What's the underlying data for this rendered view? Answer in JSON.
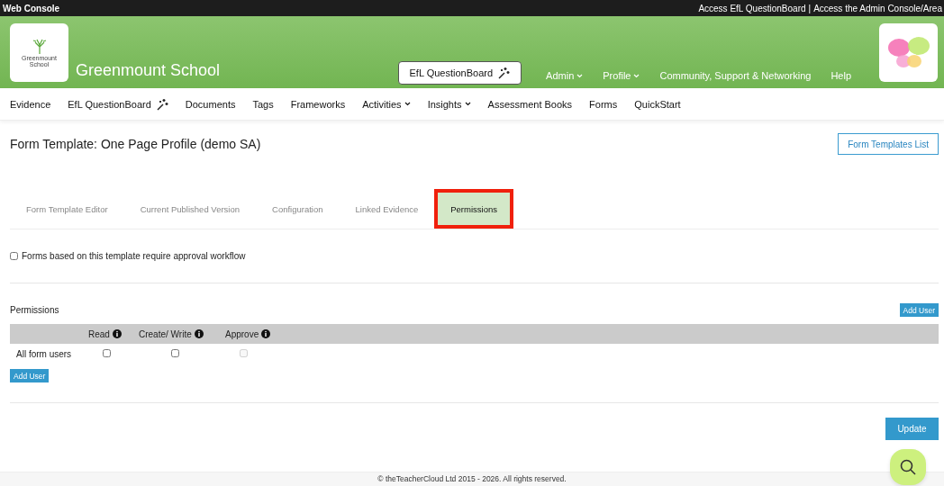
{
  "top_bar": {
    "title": "Web Console",
    "links": [
      "Access EfL QuestionBoard",
      "Access the Admin Console/Area"
    ],
    "separator": "|"
  },
  "header": {
    "school_name": "Greenmount School",
    "logo_caption": "Greenmount School",
    "questionboard_button": "EfL QuestionBoard",
    "menu": [
      {
        "label": "Admin",
        "kind": "dropdown"
      },
      {
        "label": "Profile",
        "kind": "dropdown"
      },
      {
        "label": "Community, Support & Networking",
        "kind": "link"
      },
      {
        "label": "Help",
        "kind": "link"
      }
    ]
  },
  "nav": [
    {
      "label": "Evidence",
      "kind": "link"
    },
    {
      "label": "EfL QuestionBoard",
      "kind": "wand"
    },
    {
      "label": "Documents",
      "kind": "link"
    },
    {
      "label": "Tags",
      "kind": "link"
    },
    {
      "label": "Frameworks",
      "kind": "link"
    },
    {
      "label": "Activities",
      "kind": "dropdown"
    },
    {
      "label": "Insights",
      "kind": "dropdown"
    },
    {
      "label": "Assessment Books",
      "kind": "link"
    },
    {
      "label": "Forms",
      "kind": "link"
    },
    {
      "label": "QuickStart",
      "kind": "link"
    }
  ],
  "page_title": "Form Template: One Page Profile (demo SA)",
  "list_button": "Form Templates List",
  "tabs": [
    {
      "label": "Form Template Editor",
      "selected": false,
      "highlighted": false
    },
    {
      "label": "Current Published Version",
      "selected": false,
      "highlighted": false
    },
    {
      "label": "Configuration",
      "selected": false,
      "highlighted": false
    },
    {
      "label": "Linked Evidence",
      "selected": false,
      "highlighted": false
    },
    {
      "label": "Permissions",
      "selected": true,
      "highlighted": true
    }
  ],
  "approval": {
    "label": "Forms based on this template require approval workflow",
    "checked": false
  },
  "permissions": {
    "title": "Permissions",
    "add_user_top": "Add User",
    "columns": [
      "Read",
      "Create/ Write",
      "Approve"
    ],
    "rows": [
      {
        "name": "All form users",
        "cells": [
          {
            "checked": false,
            "disabled": false
          },
          {
            "checked": false,
            "disabled": false
          },
          {
            "checked": false,
            "disabled": true
          }
        ]
      }
    ],
    "add_user_bottom": "Add User"
  },
  "update_button": "Update",
  "footer": "© theTeacherCloud Ltd 2015 - 2026. All rights reserved."
}
